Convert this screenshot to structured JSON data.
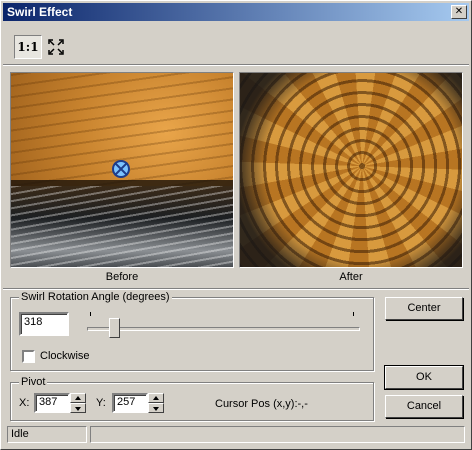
{
  "window": {
    "title": "Swirl Effect",
    "close_icon": "close-icon"
  },
  "toolbar": {
    "actual_size_label": "1:1",
    "fit_icon": "fit-to-window-icon"
  },
  "preview": {
    "before_caption": "Before",
    "after_caption": "After",
    "pivot_marker_icon": "pivot-marker-icon"
  },
  "swirl": {
    "group_title": "Swirl Rotation Angle (degrees)",
    "angle_value": "318",
    "slider_fraction": 0.09,
    "clockwise_label": "Clockwise",
    "clockwise_checked": false
  },
  "pivot": {
    "group_title": "Pivot",
    "x_label": "X:",
    "x_value": "387",
    "y_label": "Y:",
    "y_value": "257",
    "cursor_pos": "Cursor Pos (x,y):-,-"
  },
  "buttons": {
    "center": "Center",
    "ok": "OK",
    "cancel": "Cancel"
  },
  "status": {
    "state": "Idle",
    "detail": ""
  },
  "colors": {
    "titlebar_start": "#0a246a",
    "titlebar_end": "#a6caf0",
    "face": "#d4d0c8"
  }
}
